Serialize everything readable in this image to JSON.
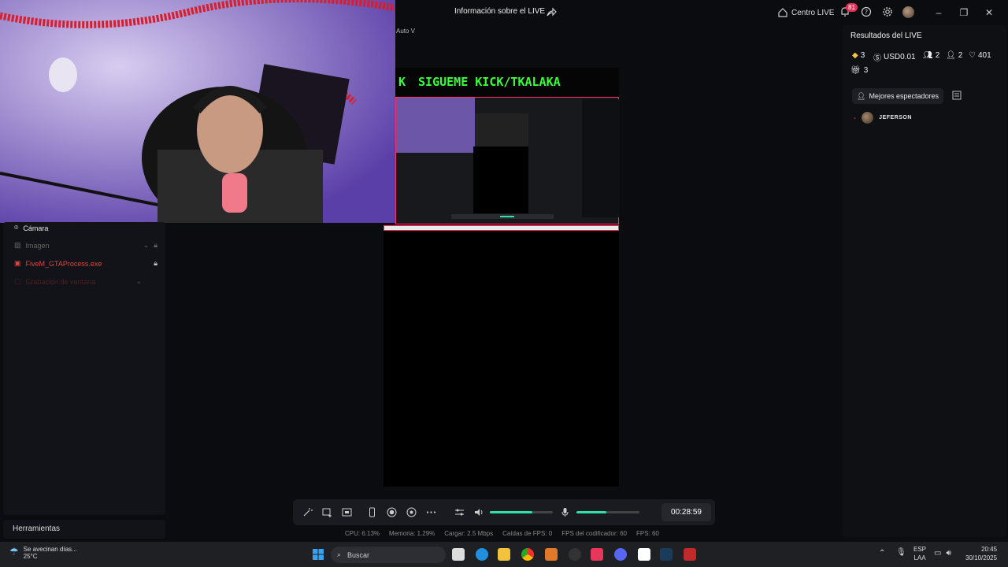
{
  "titlebar": {
    "title": "Información sobre el LIVE",
    "centro_label": "Centro LIVE",
    "notif_count": "81"
  },
  "preview": {
    "mode_label": "Auto V",
    "banner_text": "SIGUEME KICK/TKALAKA",
    "banner_glyph": "K"
  },
  "sources": {
    "items": [
      {
        "label": "Cámara",
        "state": "active"
      },
      {
        "label": "Imagen",
        "state": "dim"
      },
      {
        "label": "FiveM_GTAProcess.exe",
        "state": "error"
      },
      {
        "label": "Grabación de ventana",
        "state": "faded"
      }
    ]
  },
  "tools": {
    "label": "Herramientas"
  },
  "controls": {
    "timer": "00:28:59",
    "volume_level": 0.68,
    "mic_level": 0.48
  },
  "stats": {
    "cpu": "CPU:  6.13%",
    "memory": "Memoria:  1.29%",
    "upload": "Cargar:  2.5 Mbps",
    "fps_drops": "Caídas de FPS:  0",
    "encoder_fps": "FPS del codificador:  60",
    "fps": "FPS:  60"
  },
  "results": {
    "title": "Resultados del LIVE",
    "diamonds": "3",
    "usd": "USD0.01",
    "viewers": "2",
    "new_followers": "2",
    "likes": "401",
    "gifts": "3",
    "top_viewers_label": "Mejores espectadores",
    "top_viewer_name": "JEFERSON"
  },
  "taskbar": {
    "weather_text": "Se avecinan días...",
    "weather_temp": "25°C",
    "search_placeholder": "Buscar",
    "lang_line1": "ESP",
    "lang_line2": "LAA",
    "time": "20:45",
    "date": "30/10/2025"
  },
  "colors": {
    "accent_green": "#2fe0a8",
    "alert_red": "#e63056",
    "banner_green": "#39ff3a"
  }
}
